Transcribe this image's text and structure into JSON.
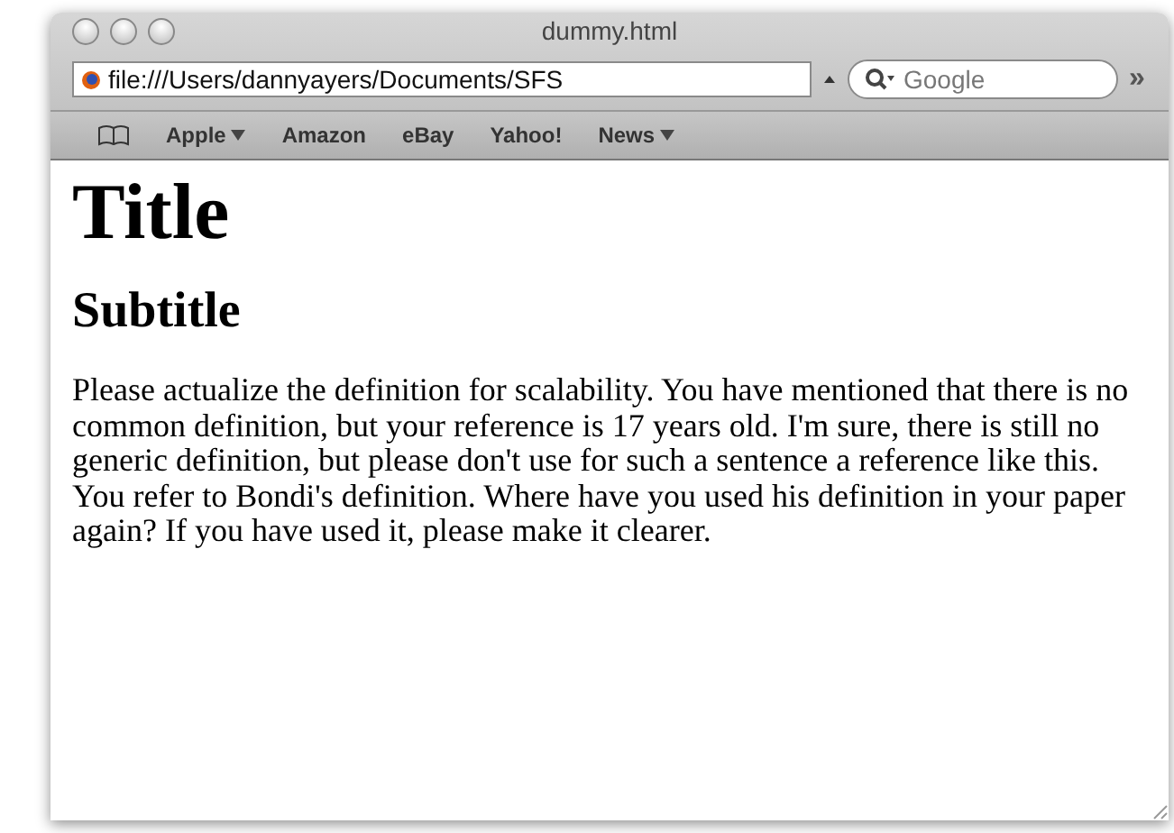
{
  "window": {
    "title": "dummy.html"
  },
  "toolbar": {
    "address": "file:///Users/dannyayers/Documents/SFS",
    "search": {
      "placeholder": "Google"
    },
    "overflow": "»"
  },
  "bookmarks": [
    {
      "label": "Apple",
      "menu": true
    },
    {
      "label": "Amazon",
      "menu": false
    },
    {
      "label": "eBay",
      "menu": false
    },
    {
      "label": "Yahoo!",
      "menu": false
    },
    {
      "label": "News",
      "menu": true
    }
  ],
  "page": {
    "title": "Title",
    "subtitle": "Subtitle",
    "paragraph": "Please actualize the definition for scalability. You have mentioned that there is no common definition, but your reference is 17 years old. I'm sure, there is still no generic definition, but please don't use for such a sentence a reference like this. You refer to Bondi's definition. Where have you used his definition in your paper again? If you have used it, please make it clearer."
  }
}
